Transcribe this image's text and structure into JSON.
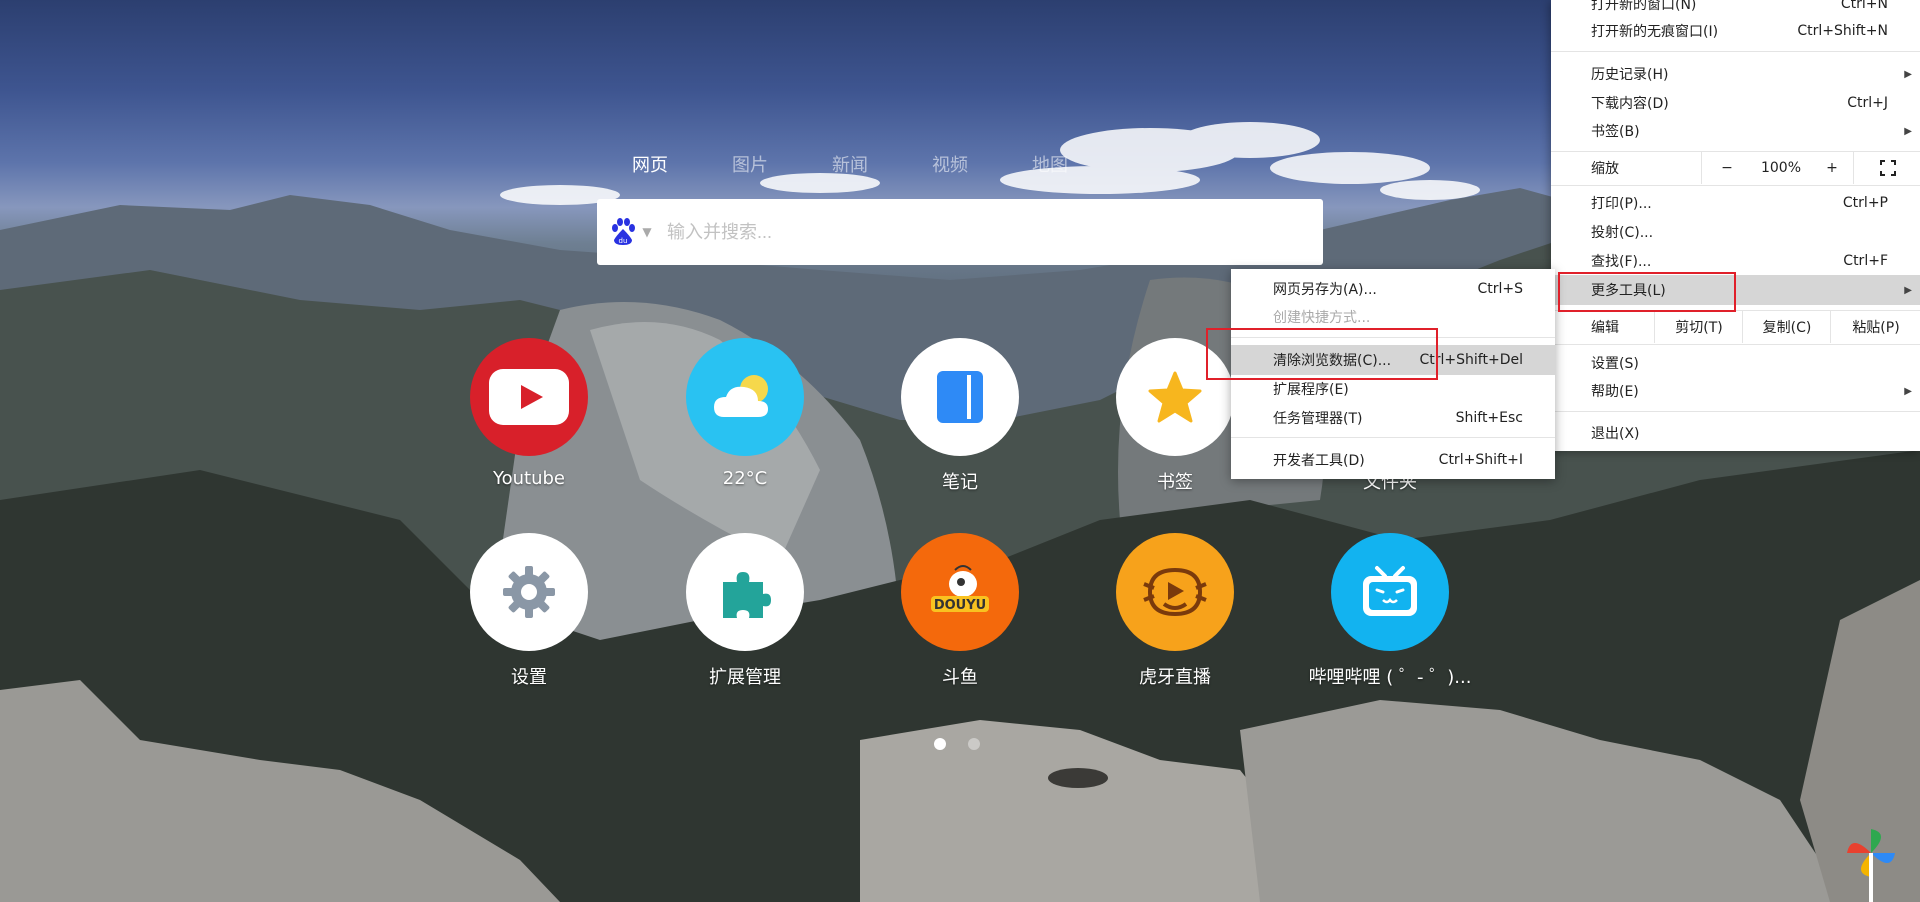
{
  "search": {
    "tabs": [
      "网页",
      "图片",
      "新闻",
      "视频",
      "地图"
    ],
    "placeholder": "输入并搜索..."
  },
  "tiles": [
    {
      "label": "Youtube",
      "icon": "youtube-icon",
      "color": "#d8202a"
    },
    {
      "label": "22°C",
      "icon": "weather-icon",
      "color": "#29c2f2"
    },
    {
      "label": "笔记",
      "icon": "notes-icon",
      "color": "#ffffff"
    },
    {
      "label": "书签",
      "icon": "star-icon",
      "color": "#ffffff"
    },
    {
      "label": "文件夹",
      "icon": "folder-icon",
      "color": "#ffffff"
    },
    {
      "label": "设置",
      "icon": "gear-icon",
      "color": "#ffffff"
    },
    {
      "label": "扩展管理",
      "icon": "puzzle-icon",
      "color": "#ffffff"
    },
    {
      "label": "斗鱼",
      "icon": "douyu-icon",
      "color": "#f4690c"
    },
    {
      "label": "虎牙直播",
      "icon": "huya-icon",
      "color": "#f7a21b"
    },
    {
      "label": "哔哩哔哩 ( ゜- ゜)...",
      "icon": "bilibili-icon",
      "color": "#12b3f0"
    }
  ],
  "main_menu": {
    "new_window": {
      "label": "打开新的窗口(N)",
      "shortcut": "Ctrl+N"
    },
    "incognito": {
      "label": "打开新的无痕窗口(I)",
      "shortcut": "Ctrl+Shift+N"
    },
    "history": {
      "label": "历史记录(H)"
    },
    "downloads": {
      "label": "下载内容(D)",
      "shortcut": "Ctrl+J"
    },
    "bookmarks": {
      "label": "书签(B)"
    },
    "zoom": {
      "label": "缩放",
      "minus": "−",
      "value": "100%",
      "plus": "+"
    },
    "print": {
      "label": "打印(P)...",
      "shortcut": "Ctrl+P"
    },
    "cast": {
      "label": "投射(C)..."
    },
    "find": {
      "label": "查找(F)...",
      "shortcut": "Ctrl+F"
    },
    "more_tools": {
      "label": "更多工具(L)"
    },
    "edit": {
      "label": "编辑",
      "cut": "剪切(T)",
      "copy": "复制(C)",
      "paste": "粘贴(P)"
    },
    "settings": {
      "label": "设置(S)"
    },
    "help": {
      "label": "帮助(E)"
    },
    "exit": {
      "label": "退出(X)"
    }
  },
  "sub_menu": {
    "save_as": {
      "label": "网页另存为(A)...",
      "shortcut": "Ctrl+S"
    },
    "create_shortcut": {
      "label": "创建快捷方式..."
    },
    "clear_data": {
      "label": "清除浏览数据(C)...",
      "shortcut": "Ctrl+Shift+Del"
    },
    "extensions": {
      "label": "扩展程序(E)"
    },
    "task_manager": {
      "label": "任务管理器(T)",
      "shortcut": "Shift+Esc"
    },
    "dev_tools": {
      "label": "开发者工具(D)",
      "shortcut": "Ctrl+Shift+I"
    }
  },
  "pagination": {
    "pages": 2,
    "current": 1
  }
}
